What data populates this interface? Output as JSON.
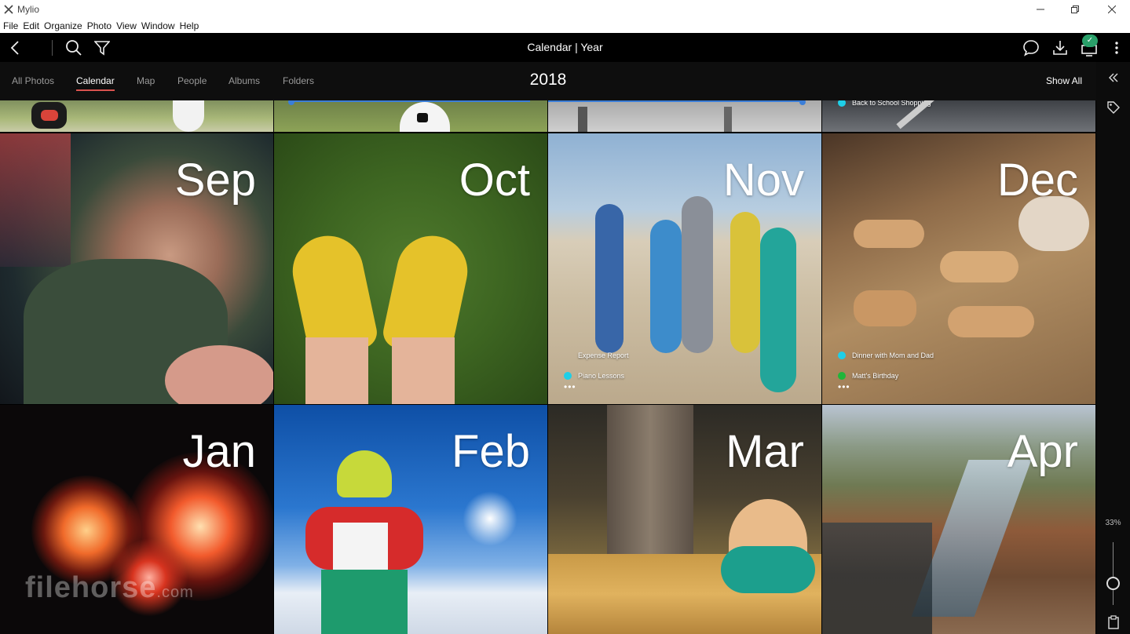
{
  "window": {
    "app_title": "Mylio"
  },
  "menu": [
    "File",
    "Edit",
    "Organize",
    "Photo",
    "View",
    "Window",
    "Help"
  ],
  "toolbar": {
    "title": "Calendar | Year"
  },
  "nav": {
    "tabs": [
      "All Photos",
      "Calendar",
      "Map",
      "People",
      "Albums",
      "Folders"
    ],
    "active": "Calendar",
    "year": "2018",
    "show_all": "Show All"
  },
  "sidebar": {
    "zoom": "33%",
    "zoom_level": 0.33
  },
  "top_row_event": "Back to School Shopping",
  "months": [
    {
      "label": "Sep",
      "events": []
    },
    {
      "label": "Oct",
      "events": []
    },
    {
      "label": "Nov",
      "events": [
        {
          "text": "Expense Report",
          "color": ""
        },
        {
          "text": "Piano Lessons",
          "color": "#1ecfe8"
        }
      ],
      "more": "•••"
    },
    {
      "label": "Dec",
      "events": [
        {
          "text": "Dinner with Mom and Dad",
          "color": "#1ecfe8"
        },
        {
          "text": "Matt's Birthday",
          "color": "#1fb53a"
        }
      ],
      "more": "•••"
    },
    {
      "label": "Jan",
      "events": []
    },
    {
      "label": "Feb",
      "events": []
    },
    {
      "label": "Mar",
      "events": []
    },
    {
      "label": "Apr",
      "events": []
    }
  ],
  "watermark": {
    "brand": "filehorse",
    "suffix": ".com"
  },
  "colors": {
    "accent": "#d9534f",
    "sync": "#2aa06a",
    "event_cyan": "#1ecfe8",
    "event_green": "#1fb53a"
  }
}
